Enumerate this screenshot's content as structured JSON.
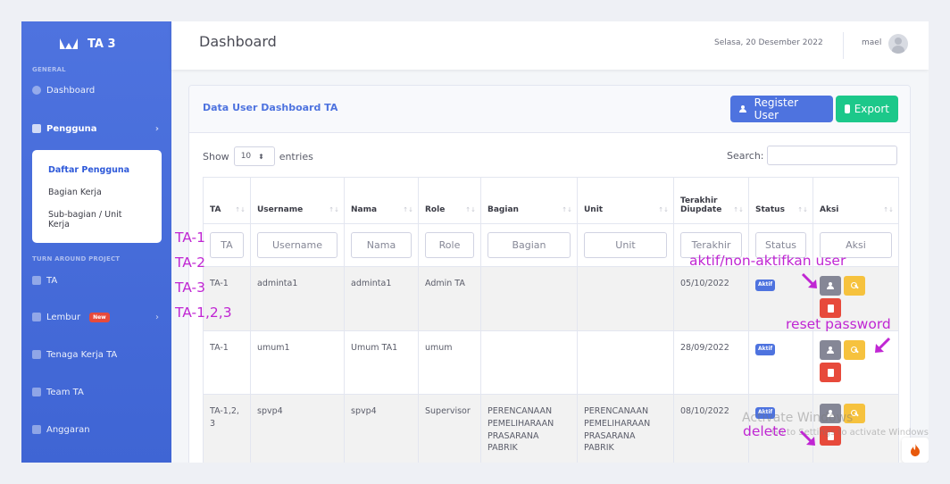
{
  "sidebar": {
    "brand": "TA 3",
    "heading_general": "GENERAL",
    "dashboard": "Dashboard",
    "pengguna": "Pengguna",
    "submenu": [
      "Daftar Pengguna",
      "Bagian Kerja",
      "Sub-bagian / Unit Kerja"
    ],
    "heading_project": "TURN AROUND PROJECT",
    "ta": "TA",
    "lembur": "Lembur",
    "lembur_badge": "New",
    "tenaga_kerja": "Tenaga Kerja TA",
    "team": "Team TA",
    "anggaran": "Anggaran"
  },
  "topbar": {
    "title": "Dashboard",
    "date": "Selasa, 20 Desember 2022",
    "user": "mael"
  },
  "card": {
    "title": "Data User Dashboard TA",
    "register_button": "Register User",
    "export_button": "Export",
    "show": "Show",
    "entries_value": "10",
    "entries": "entries",
    "search_label": "Search:"
  },
  "table": {
    "headers": [
      "TA",
      "Username",
      "Nama",
      "Role",
      "Bagian",
      "Unit",
      "Terakhir Diupdate",
      "Status",
      "Aksi"
    ],
    "filters": [
      "TA",
      "Username",
      "Nama",
      "Role",
      "Bagian",
      "Unit",
      "Terakhir",
      "Status",
      "Aksi"
    ],
    "rows": [
      {
        "ta": "TA-1",
        "username": "adminta1",
        "nama": "adminta1",
        "role": "Admin TA",
        "bagian": "",
        "unit": "",
        "updated": "05/10/2022",
        "status": "Aktif"
      },
      {
        "ta": "TA-1",
        "username": "umum1",
        "nama": "Umum TA1",
        "role": "umum",
        "bagian": "",
        "unit": "",
        "updated": "28/09/2022",
        "status": "Aktif"
      },
      {
        "ta": "TA-1,2,3",
        "username": "spvp4",
        "nama": "spvp4",
        "role": "Supervisor",
        "bagian": "PERENCANAAN PEMELIHARAAN PRASARANA PABRIK",
        "unit": "PERENCANAAN PEMELIHARAAN PRASARANA PABRIK",
        "updated": "08/10/2022",
        "status": "Aktif"
      }
    ]
  },
  "annotations": {
    "ta_labels": [
      "TA-1",
      "TA-2",
      "TA-3",
      "TA-1,2,3"
    ],
    "activate": "aktif/non-aktifkan user",
    "reset": "reset password",
    "delete": "delete",
    "color": "#c026d3"
  },
  "watermark": {
    "line1": "Activate Windows",
    "line2": "Go to Settings to activate Windows."
  },
  "colors": {
    "primary": "#4e73df",
    "success": "#1cc88a",
    "warning": "#f6c23e",
    "danger": "#e74a3b",
    "secondary": "#858796"
  }
}
